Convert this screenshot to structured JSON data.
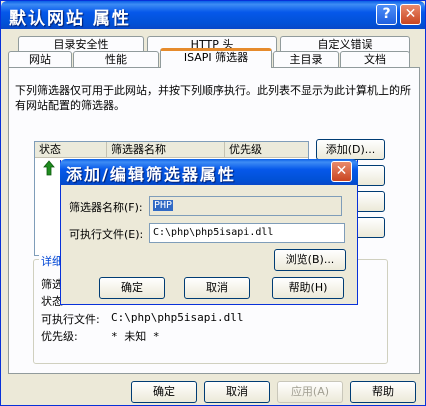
{
  "window": {
    "title": "默认网站 属性",
    "help_glyph": "?",
    "close_glyph": "✕"
  },
  "tabs": {
    "row1": [
      "目录安全性",
      "HTTP 头",
      "自定义错误"
    ],
    "row2": [
      "网站",
      "性能",
      "ISAPI 筛选器",
      "主目录",
      "文档"
    ],
    "active": "ISAPI 筛选器"
  },
  "description": "下列筛选器仅可用于此网站，并按下列顺序执行。此列表不显示为此计算机上的所有网站配置的筛选器。",
  "filter_list": {
    "columns": [
      "状态",
      "筛选器名称",
      "优先级"
    ],
    "row_status_icon": "up-arrow-icon"
  },
  "side_buttons": {
    "add": "添加(D)..."
  },
  "details": {
    "group_title": "详细",
    "rows": [
      {
        "label": "筛选",
        "value": ""
      },
      {
        "label": "状态",
        "value": ""
      },
      {
        "label": "可执行文件:",
        "value": "C:\\php\\php5isapi.dll"
      },
      {
        "label": "优先级:",
        "value": "* 未知 *"
      }
    ]
  },
  "bottom_buttons": {
    "ok": "确定",
    "cancel": "取消",
    "apply": "应用(A)",
    "help": "帮助"
  },
  "dialog": {
    "title": "添加/编辑筛选器属性",
    "close_glyph": "✕",
    "filter_name_label": "筛选器名称(F):",
    "filter_name_value": "PHP",
    "executable_label": "可执行文件(E):",
    "executable_value": "C:\\php\\php5isapi.dll",
    "browse": "浏览(B)...",
    "ok": "确定",
    "cancel": "取消",
    "help": "帮助(H)"
  }
}
